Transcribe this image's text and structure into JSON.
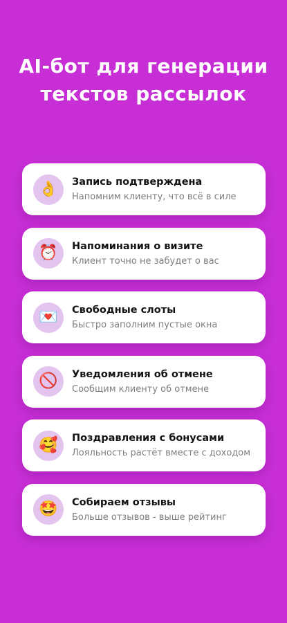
{
  "headline": {
    "line1": "AI-бот для генерации",
    "line2": "текстов рассылок"
  },
  "colors": {
    "background": "#C82ED6",
    "card": "#FFFFFF",
    "icon_circle": "#E3C4EF",
    "title": "#141414",
    "subtitle": "#7D7D82"
  },
  "cards": [
    {
      "title": "Запись подтверждена",
      "subtitle": "Напомним клиенту, что всё в силе",
      "icon": "ok-hand-icon",
      "glyph": "👌"
    },
    {
      "title": "Напоминания о визите",
      "subtitle": "Клиент точно не забудет о вас",
      "icon": "alarm-clock-icon",
      "glyph": "⏰"
    },
    {
      "title": "Свободные слоты",
      "subtitle": "Быстро заполним пустые окна",
      "icon": "love-letter-icon",
      "glyph": "💌"
    },
    {
      "title": "Уведомления об отмене",
      "subtitle": "Сообщим клиенту об отмене",
      "icon": "prohibited-icon",
      "glyph": "🚫"
    },
    {
      "title": "Поздравления с бонусами",
      "subtitle": "Лояльность растёт вместе с доходом",
      "icon": "smiling-hearts-icon",
      "glyph": "🥰"
    },
    {
      "title": "Собираем отзывы",
      "subtitle": "Больше отзывов - выше рейтинг",
      "icon": "star-struck-icon",
      "glyph": "🤩"
    }
  ]
}
